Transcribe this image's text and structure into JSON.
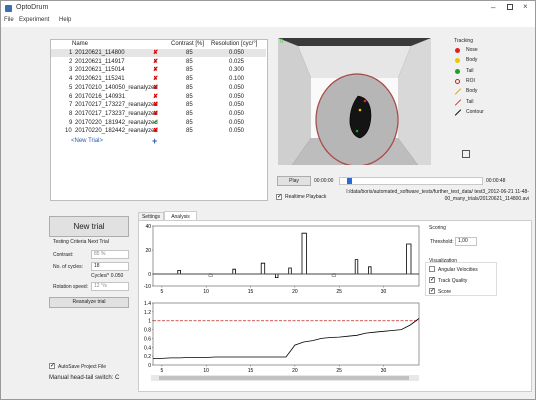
{
  "window": {
    "title": "OptoDrum"
  },
  "menu": [
    "File",
    "Experiment",
    "Help"
  ],
  "trials_table": {
    "headers": [
      "Name",
      "",
      "Contrast [%]",
      "Resolution [cyc/°]"
    ],
    "rows": [
      {
        "idx": "1",
        "name": "20120621_114800",
        "status": "x",
        "contrast": "85",
        "resolution": "0.050"
      },
      {
        "idx": "2",
        "name": "20120621_114917",
        "status": "x",
        "contrast": "85",
        "resolution": "0.025"
      },
      {
        "idx": "3",
        "name": "20120621_115014",
        "status": "x",
        "contrast": "85",
        "resolution": "0.300"
      },
      {
        "idx": "4",
        "name": "20120621_115241",
        "status": "x",
        "contrast": "85",
        "resolution": "0.100"
      },
      {
        "idx": "5",
        "name": "20170210_140050_reanalyzed",
        "status": "x",
        "contrast": "85",
        "resolution": "0.050"
      },
      {
        "idx": "6",
        "name": "20170216_140931",
        "status": "x",
        "contrast": "85",
        "resolution": "0.050"
      },
      {
        "idx": "7",
        "name": "20170217_173227_reanalyzed",
        "status": "x",
        "contrast": "85",
        "resolution": "0.050"
      },
      {
        "idx": "8",
        "name": "20170217_173237_reanalyzed",
        "status": "x",
        "contrast": "85",
        "resolution": "0.050"
      },
      {
        "idx": "9",
        "name": "20170220_181942_reanalyzed",
        "status": "check",
        "contrast": "85",
        "resolution": "0.050"
      },
      {
        "idx": "10",
        "name": "20170220_182442_reanalyzed",
        "status": "x",
        "contrast": "85",
        "resolution": "0.050"
      }
    ],
    "new_trial_link": "<New Trial>"
  },
  "video": {
    "corner_label": "0",
    "play_label": "Play",
    "time_start": "00:00:00",
    "time_end": "00:00:48",
    "progress": 0.05,
    "realtime_label": "Realtime Playback",
    "realtime_checked": true,
    "path": "I:/data/boris/automated_software_tests/further_test_data/ test3_2012-06-21 11-48-00_many_trials/20120621_114800.avi"
  },
  "tracking": {
    "title": "Tracking",
    "items": [
      {
        "label": "Nose",
        "color": "#e02020",
        "kind": "dot"
      },
      {
        "label": "Body",
        "color": "#e8c800",
        "kind": "dot"
      },
      {
        "label": "Tail",
        "color": "#20a020",
        "kind": "dot"
      },
      {
        "label": "ROI",
        "color": "#c02020",
        "kind": "ring"
      },
      {
        "label": "Body",
        "color": "#e8a000",
        "kind": "line"
      },
      {
        "label": "Tail",
        "color": "#c04040",
        "kind": "line"
      },
      {
        "label": "Contour",
        "color": "#000000",
        "kind": "line"
      }
    ]
  },
  "left": {
    "new_trial_button": "New trial",
    "criteria_title": "Testing Criteria Next Trial",
    "contrast_label": "Contrast:",
    "contrast_value": "85 %",
    "cycles_label": "No. of cycles:",
    "cycles_value": "18",
    "cycles_deg": "Cycles/° 0.050",
    "rotation_label": "Rotation speed:",
    "rotation_value": "12 °/s",
    "reanalyze_button": "Reanalyze trial",
    "autosave_label": "AutoSave Project File",
    "autosave_checked": true,
    "head_tail_label": "Manual head-tail switch: C"
  },
  "tabs": [
    "Settings",
    "Analysis"
  ],
  "active_tab": "Analysis",
  "scoring": {
    "title": "Scoring",
    "threshold_label": "Threshold:",
    "threshold_value": "1,00",
    "visualization_title": "Visualization",
    "options": [
      {
        "label": "Angular Velocities",
        "checked": false
      },
      {
        "label": "Track Quality",
        "checked": true
      },
      {
        "label": "Score",
        "checked": true
      }
    ]
  },
  "chart_data": [
    {
      "type": "line",
      "ylim": [
        -10,
        40
      ],
      "xlim": [
        4,
        34
      ],
      "yticks": [
        "40",
        "20",
        "0",
        "-10"
      ],
      "xticks": [
        "5",
        "10",
        "15",
        "20",
        "25",
        "30"
      ],
      "series": [
        {
          "x": [
            4,
            6.8,
            6.8,
            7.1,
            7.1,
            13,
            13,
            13.3,
            13.3,
            16.2,
            16.2,
            16.6,
            16.6,
            17.8,
            17.8,
            18.1,
            18.1,
            19.3,
            19.3,
            19.6,
            19.6,
            20.8,
            20.8,
            21.3,
            21.3,
            26.8,
            26.8,
            27.1,
            27.1,
            28.3,
            28.3,
            28.6,
            28.6,
            32.6,
            32.6,
            33.1,
            33.1,
            34
          ],
          "y": [
            0,
            0,
            3,
            3,
            0,
            0,
            4,
            4,
            0,
            0,
            9,
            9,
            0,
            0,
            -3,
            -3,
            0,
            0,
            5,
            5,
            0,
            0,
            34,
            34,
            0,
            0,
            12,
            12,
            0,
            0,
            6,
            6,
            0,
            0,
            25,
            25,
            0,
            0
          ]
        },
        {
          "x": [
            4,
            10.3,
            10.3,
            10.7,
            10.7,
            24.2,
            24.2,
            24.6,
            24.6,
            34
          ],
          "y": [
            0,
            0,
            -2,
            -2,
            0,
            0,
            -2,
            -2,
            0,
            0
          ]
        }
      ]
    },
    {
      "type": "line",
      "ylim": [
        0,
        1.4
      ],
      "xlim": [
        4,
        34
      ],
      "yticks": [
        "1.4",
        "1.2",
        "1",
        "0.8",
        "0.6",
        "0.4",
        "0.2",
        "0"
      ],
      "xticks": [
        "5",
        "10",
        "15",
        "20",
        "25",
        "30"
      ],
      "threshold": 1.0,
      "series": [
        {
          "x": [
            4,
            5,
            6,
            7,
            8,
            9,
            10,
            11,
            12,
            13,
            14,
            15,
            16,
            17,
            18,
            19,
            20,
            21,
            22,
            23,
            24,
            25,
            26,
            27,
            28,
            29,
            30,
            31,
            32,
            33,
            34
          ],
          "y": [
            0.15,
            0.15,
            0.16,
            0.16,
            0.17,
            0.17,
            0.17,
            0.18,
            0.18,
            0.18,
            0.18,
            0.18,
            0.18,
            0.18,
            0.18,
            0.18,
            0.45,
            0.52,
            0.55,
            0.6,
            0.62,
            0.63,
            0.65,
            0.67,
            0.72,
            0.74,
            0.76,
            0.78,
            0.8,
            0.9,
            1.05
          ]
        }
      ]
    }
  ]
}
